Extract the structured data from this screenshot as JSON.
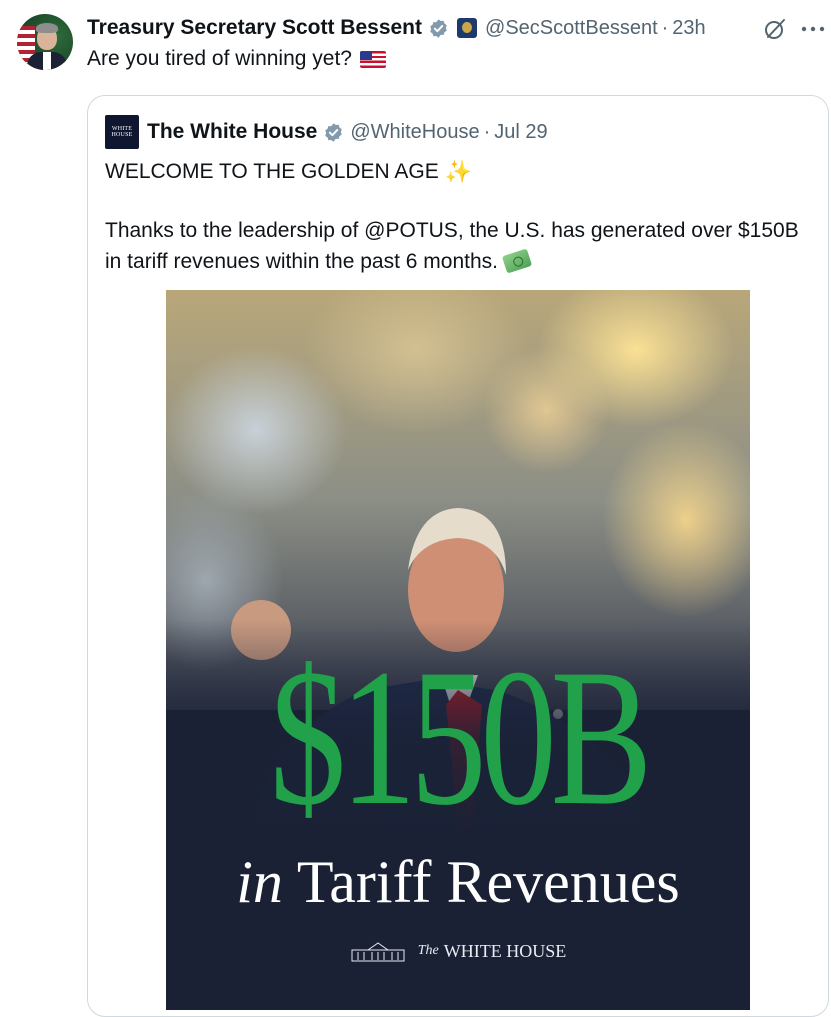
{
  "tweet": {
    "author": {
      "display_name": "Treasury Secretary Scott Bessent",
      "handle": "@SecScottBessent",
      "time": "23h",
      "verified": true,
      "verified_color": "#829aab",
      "affiliate_badge_icon": "treasury-seal-icon"
    },
    "text": "Are you tired of winning yet?",
    "text_emoji": "us-flag-icon",
    "actions": {
      "grok_icon": "grok-icon",
      "more_icon": "more-icon"
    },
    "separator": "·"
  },
  "quote": {
    "author": {
      "display_name": "The White House",
      "handle": "@WhiteHouse",
      "time": "Jul 29",
      "logo_text_top": "WHITE",
      "logo_text_bottom": "HOUSE",
      "verified": true
    },
    "line1": "WELCOME TO THE GOLDEN AGE",
    "line1_emoji": "✨",
    "line2": "Thanks to the leadership of @POTUS, the U.S. has generated over $150B in tariff revenues within the past 6 months.",
    "line2_emoji": "money-with-wings-icon",
    "media": {
      "headline": "$150B",
      "subline_prefix": "in",
      "subline_rest": "Tariff Revenues",
      "brand_the": "The",
      "brand_name": "WHITE HOUSE",
      "headline_color": "#20a14a",
      "background_color": "#1a2135"
    }
  }
}
